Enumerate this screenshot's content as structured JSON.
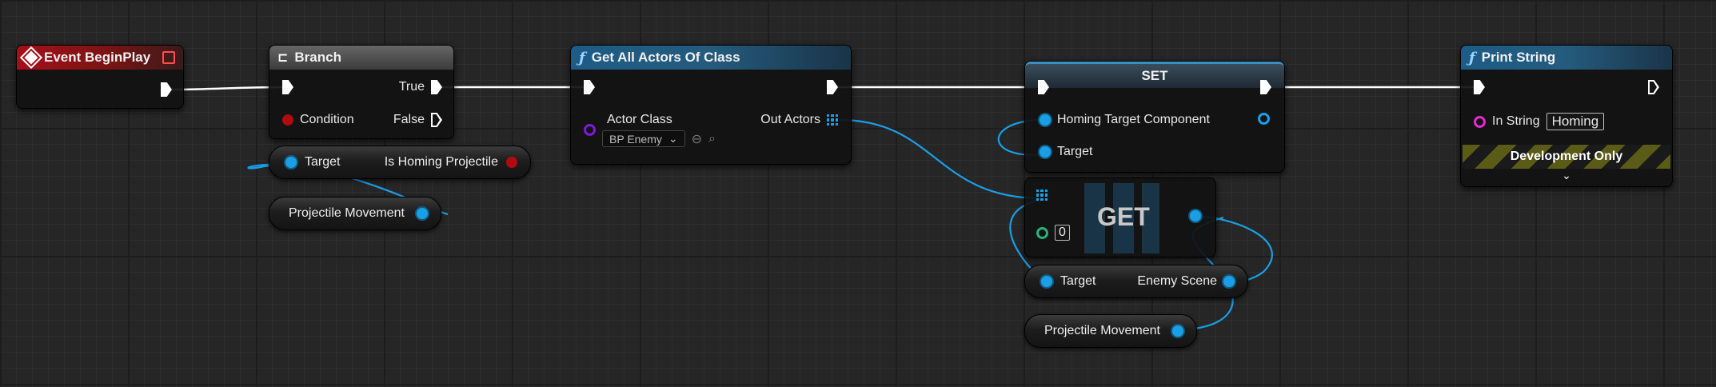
{
  "nodes": {
    "event_beginplay": {
      "title": "Event BeginPlay"
    },
    "branch": {
      "title": "Branch",
      "true_label": "True",
      "condition_label": "Condition",
      "false_label": "False"
    },
    "get_all_actors": {
      "title": "Get All Actors Of Class",
      "actor_class_label": "Actor Class",
      "actor_class_value": "BP Enemy",
      "out_actors_label": "Out Actors"
    },
    "set": {
      "title": "SET",
      "homing_target_label": "Homing Target Component",
      "target_label": "Target"
    },
    "get": {
      "title": "GET",
      "index_value": "0"
    },
    "print_string": {
      "title": "Print String",
      "in_string_label": "In String",
      "in_string_value": "Homing",
      "dev_only_label": "Development Only"
    }
  },
  "pills": {
    "is_homing": {
      "target_label": "Target",
      "value_label": "Is Homing Projectile"
    },
    "proj_movement_left": {
      "label": "Projectile Movement"
    },
    "enemy_scene": {
      "target_label": "Target",
      "value_label": "Enemy Scene"
    },
    "proj_movement_right": {
      "label": "Projectile Movement"
    }
  },
  "colors": {
    "exec_wire": "#ffffff",
    "object_wire": "#1a9fe6",
    "event_header": "#a5101a",
    "function_header": "#1d5c86",
    "bool_pin": "#b10b10",
    "class_pin": "#7d1bd6",
    "int_pin": "#27b37a",
    "string_pin": "#e22ad0"
  }
}
